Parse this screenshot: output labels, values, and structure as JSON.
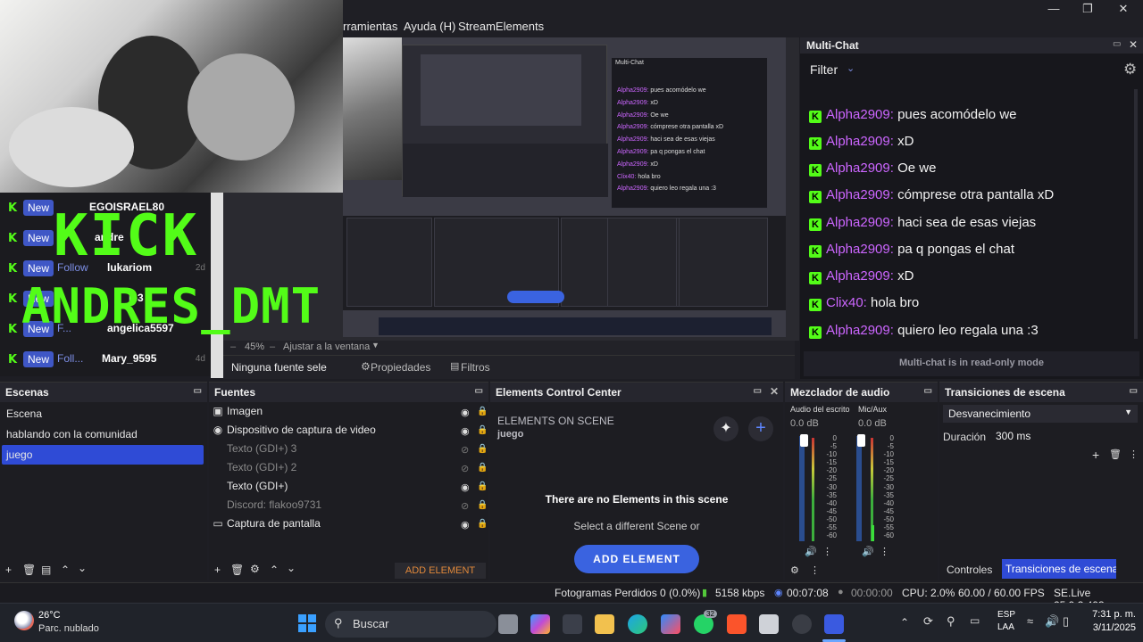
{
  "menu": {
    "items": [
      "rramientas",
      "Ayuda (H)",
      "StreamElements"
    ]
  },
  "overlay": {
    "kick_title": "KICK",
    "kick_user": "ANDRES_DMT",
    "events": [
      {
        "badge": "New",
        "type": "",
        "user": "EGOISRAEL80",
        "time": ""
      },
      {
        "badge": "New",
        "type": "",
        "user": "andre",
        "time": ""
      },
      {
        "badge": "New",
        "type": "Follow",
        "user": "lukariom",
        "time": "2d"
      },
      {
        "badge": "New",
        "type": "",
        "user": "le3",
        "time": ""
      },
      {
        "badge": "New",
        "type": "F...",
        "user": "angelica5597",
        "time": ""
      },
      {
        "badge": "New",
        "type": "Foll...",
        "user": "Mary_9595",
        "time": "4d"
      }
    ]
  },
  "preview_toolbar": {
    "zoom": "45%",
    "fit_label": "Ajustar a la ventana",
    "no_source": "Ninguna fuente sele",
    "properties": "Propiedades",
    "filters": "Filtros"
  },
  "multichat": {
    "title": "Multi-Chat",
    "filter": "Filter",
    "footer": "Multi-chat is in read-only mode",
    "messages": [
      {
        "user": "Alpha2909:",
        "text": "pues acomódelo we"
      },
      {
        "user": "Alpha2909:",
        "text": "xD"
      },
      {
        "user": "Alpha2909:",
        "text": "Oe we"
      },
      {
        "user": "Alpha2909:",
        "text": "cómprese otra pantalla xD"
      },
      {
        "user": "Alpha2909:",
        "text": "haci sea de esas viejas"
      },
      {
        "user": "Alpha2909:",
        "text": "pa q pongas el chat"
      },
      {
        "user": "Alpha2909:",
        "text": "xD"
      },
      {
        "user": "Clix40:",
        "text": "hola bro"
      },
      {
        "user": "Alpha2909:",
        "text": "quiero leo regala una :3"
      }
    ]
  },
  "scenes": {
    "title": "Escenas",
    "items": [
      "Escena",
      "hablando con la comunidad",
      "juego"
    ],
    "selected": "juego"
  },
  "sources": {
    "title": "Fuentes",
    "items": [
      {
        "icon": "image-icon",
        "label": "Imagen",
        "visible": true
      },
      {
        "icon": "camera-icon",
        "label": "Dispositivo de captura de video",
        "visible": true
      },
      {
        "icon": "text-icon",
        "label": "Texto (GDI+) 3",
        "visible": false
      },
      {
        "icon": "text-icon",
        "label": "Texto (GDI+) 2",
        "visible": false
      },
      {
        "icon": "text-icon",
        "label": "Texto (GDI+)",
        "visible": true
      },
      {
        "icon": "discord-icon",
        "label": "Discord: flakoo9731",
        "visible": false
      },
      {
        "icon": "monitor-icon",
        "label": "Captura de pantalla",
        "visible": true
      }
    ],
    "add_element": "ADD ELEMENT"
  },
  "elements": {
    "title": "Elements Control Center",
    "on_scene": "ELEMENTS ON SCENE",
    "scene_name": "juego",
    "empty_title": "There are no Elements in this scene",
    "empty_sub": "Select a different Scene or",
    "add_button": "ADD ELEMENT"
  },
  "mixer": {
    "title": "Mezclador de audio",
    "channels": [
      {
        "name": "Audio del escrito",
        "db": "0.0 dB"
      },
      {
        "name": "Mic/Aux",
        "db": "0.0 dB"
      }
    ],
    "scale": [
      "0",
      "-5",
      "-10",
      "-15",
      "-20",
      "-25",
      "-30",
      "-35",
      "-40",
      "-45",
      "-50",
      "-55",
      "-60"
    ]
  },
  "transitions": {
    "title": "Transiciones de escena",
    "selected": "Desvanecimiento",
    "duration_label": "Duración",
    "duration": "300 ms",
    "tab_controls": "Controles",
    "tab_transitions": "Transiciones de escena"
  },
  "status": {
    "dropped": "Fotogramas Perdidos 0 (0.0%)",
    "bitrate": "5158 kbps",
    "stream_time": "00:07:08",
    "rec_time": "00:00:00",
    "cpu": "CPU: 2.0%",
    "fps": "60.00 / 60.00 FPS",
    "version": "SE.Live 25.9.3.493"
  },
  "taskbar": {
    "weather_temp": "26°C",
    "weather_desc": "Parc. nublado",
    "search": "Buscar",
    "lang1": "ESP",
    "lang2": "LAA",
    "time": "7:31 p. m.",
    "date": "3/11/2025",
    "badge": "32"
  },
  "colors": {
    "kick_green": "#53fc18",
    "accent_blue": "#3f57c6",
    "selection_blue": "#2f4bd6",
    "chat_name": "#cc66ff",
    "add_orange": "#e0883a"
  }
}
